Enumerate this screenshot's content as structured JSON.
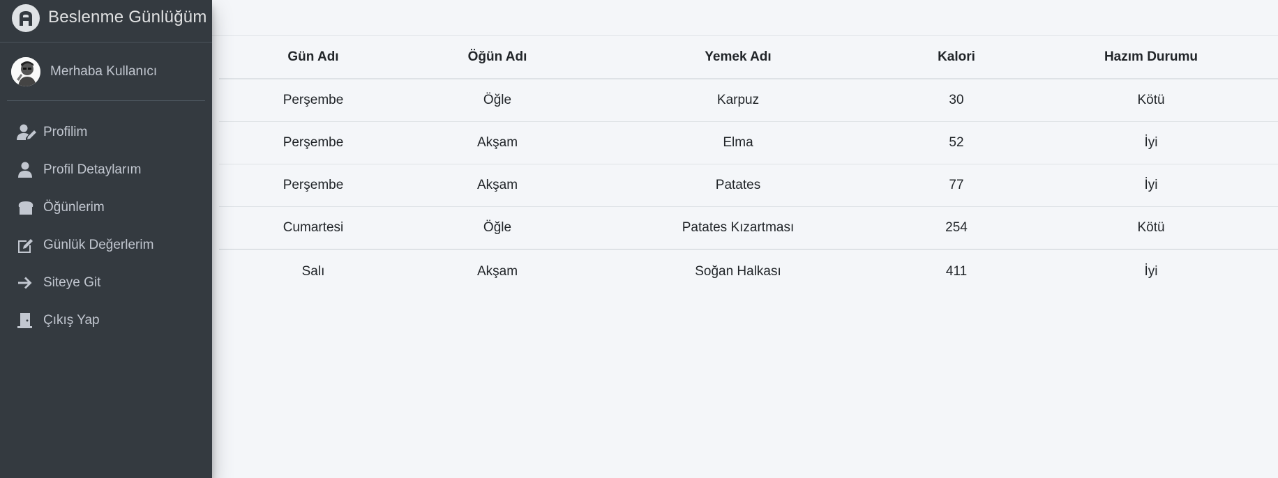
{
  "brand": {
    "title": "Beslenme Günlüğüm"
  },
  "user": {
    "greeting": "Merhaba Kullanıcı"
  },
  "sidebar": {
    "items": [
      {
        "label": "Profilim",
        "icon": "user-edit-icon"
      },
      {
        "label": "Profil Detaylarım",
        "icon": "user-icon"
      },
      {
        "label": "Öğünlerim",
        "icon": "bread-icon"
      },
      {
        "label": "Günlük Değerlerim",
        "icon": "edit-icon"
      },
      {
        "label": "Siteye Git",
        "icon": "arrow-right-icon"
      },
      {
        "label": "Çıkış Yap",
        "icon": "door-icon"
      }
    ]
  },
  "table": {
    "headers": [
      "Gün Adı",
      "Öğün Adı",
      "Yemek Adı",
      "Kalori",
      "Hazım Durumu"
    ],
    "rows": [
      [
        "Perşembe",
        "Öğle",
        "Karpuz",
        "30",
        "Kötü"
      ],
      [
        "Perşembe",
        "Akşam",
        "Elma",
        "52",
        "İyi"
      ],
      [
        "Perşembe",
        "Akşam",
        "Patates",
        "77",
        "İyi"
      ],
      [
        "Cumartesi",
        "Öğle",
        "Patates Kızartması",
        "254",
        "Kötü"
      ],
      [
        "Salı",
        "Akşam",
        "Soğan Halkası",
        "411",
        "İyi"
      ]
    ]
  },
  "colors": {
    "sidebar_bg": "#343a40",
    "page_bg": "#f4f6f9",
    "nav_text": "#c2c7d0"
  }
}
